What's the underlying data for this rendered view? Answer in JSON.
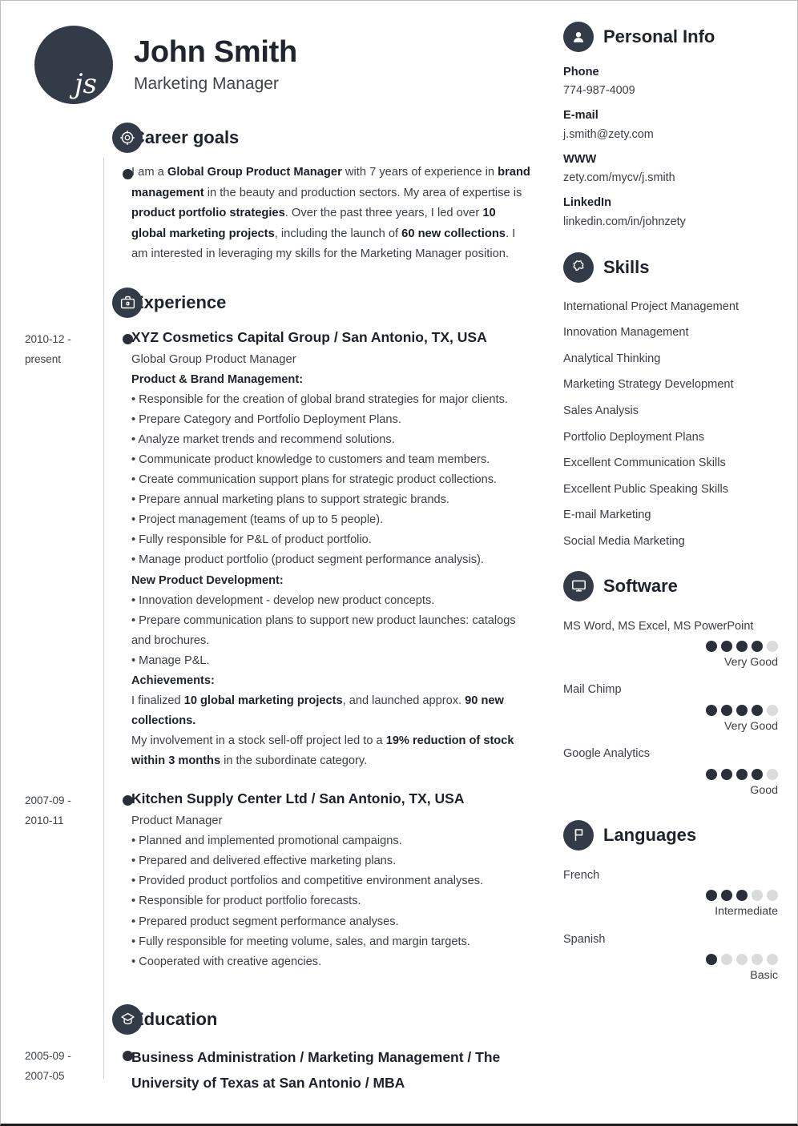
{
  "header": {
    "avatar_initials": "js",
    "full_name": "John Smith",
    "job_title": "Marketing Manager"
  },
  "sections": {
    "career_goals": {
      "title": "Career goals",
      "icon": "target-icon",
      "text_parts": [
        {
          "t": "I am a ",
          "b": false
        },
        {
          "t": "Global Group Product Manager",
          "b": true
        },
        {
          "t": " with 7 years of experience in ",
          "b": false
        },
        {
          "t": "brand management",
          "b": true
        },
        {
          "t": " in the beauty and production sectors. My area of expertise is ",
          "b": false
        },
        {
          "t": "product portfolio strategies",
          "b": true
        },
        {
          "t": ". Over the past three years, I led over ",
          "b": false
        },
        {
          "t": "10 global marketing projects",
          "b": true
        },
        {
          "t": ", including the launch of ",
          "b": false
        },
        {
          "t": "60 new collections",
          "b": true
        },
        {
          "t": ". I am interested in leveraging my skills for the Marketing Manager position.",
          "b": false
        }
      ]
    },
    "experience": {
      "title": "Experience",
      "icon": "briefcase-icon",
      "entries": [
        {
          "date": "2010-12 - present",
          "heading": "XYZ Cosmetics Capital Group / San Antonio, TX, USA",
          "subtitle": "Global Group Product Manager",
          "blocks": [
            {
              "kind": "group",
              "text": "Product & Brand Management:"
            },
            {
              "kind": "bullet",
              "text": "• Responsible for the creation of global brand strategies for major clients."
            },
            {
              "kind": "bullet",
              "text": "• Prepare Category and Portfolio Deployment Plans."
            },
            {
              "kind": "bullet",
              "text": "• Analyze market trends and recommend solutions."
            },
            {
              "kind": "bullet",
              "text": "• Communicate product knowledge to customers and team members."
            },
            {
              "kind": "bullet",
              "text": "• Create communication support plans for strategic product collections."
            },
            {
              "kind": "bullet",
              "text": "• Prepare annual marketing plans to support strategic brands."
            },
            {
              "kind": "bullet",
              "text": "• Project management (teams of up to 5 people)."
            },
            {
              "kind": "bullet",
              "text": "• Fully responsible for P&L of product portfolio."
            },
            {
              "kind": "bullet",
              "text": "• Manage product portfolio (product segment performance analysis)."
            },
            {
              "kind": "group",
              "text": "New Product Development:"
            },
            {
              "kind": "bullet",
              "text": "• Innovation development - develop new product concepts."
            },
            {
              "kind": "bullet",
              "text": "• Prepare communication plans to support new product launches: catalogs and brochures."
            },
            {
              "kind": "bullet",
              "text": "• Manage P&L."
            },
            {
              "kind": "group",
              "text": "Achievements:"
            },
            {
              "kind": "rich",
              "parts": [
                {
                  "t": "I finalized ",
                  "b": false
                },
                {
                  "t": "10 global marketing projects",
                  "b": true
                },
                {
                  "t": ", and launched approx. ",
                  "b": false
                },
                {
                  "t": "90 new collections.",
                  "b": true
                }
              ]
            },
            {
              "kind": "rich",
              "parts": [
                {
                  "t": "My involvement in a stock sell-off project led to a ",
                  "b": false
                },
                {
                  "t": "19% reduction of stock within 3 months",
                  "b": true
                },
                {
                  "t": " in the subordinate category.",
                  "b": false
                }
              ]
            }
          ]
        },
        {
          "date": "2007-09 - 2010-11",
          "heading": "Kitchen Supply Center Ltd / San Antonio, TX, USA",
          "subtitle": "Product Manager",
          "blocks": [
            {
              "kind": "bullet",
              "text": "• Planned and implemented promotional campaigns."
            },
            {
              "kind": "bullet",
              "text": "• Prepared and delivered effective marketing plans."
            },
            {
              "kind": "bullet",
              "text": "• Provided product portfolios and competitive environment analyses."
            },
            {
              "kind": "bullet",
              "text": "• Responsible for product portfolio forecasts."
            },
            {
              "kind": "bullet",
              "text": "• Prepared product segment performance analyses."
            },
            {
              "kind": "bullet",
              "text": "• Fully responsible for meeting volume, sales, and margin targets."
            },
            {
              "kind": "bullet",
              "text": "• Cooperated with creative agencies."
            }
          ]
        }
      ]
    },
    "education": {
      "title": "Education",
      "icon": "graduation-cap-icon",
      "entries": [
        {
          "date": "2005-09 - 2007-05",
          "heading": "Business Administration / Marketing Management / The University of Texas at San Antonio / MBA"
        }
      ]
    }
  },
  "sidebar": {
    "personal_info": {
      "title": "Personal Info",
      "icon": "person-icon",
      "fields": [
        {
          "label": "Phone",
          "value": "774-987-4009"
        },
        {
          "label": "E-mail",
          "value": "j.smith@zety.com"
        },
        {
          "label": "WWW",
          "value": "zety.com/mycv/j.smith"
        },
        {
          "label": "LinkedIn",
          "value": "linkedin.com/in/johnzety"
        }
      ]
    },
    "skills": {
      "title": "Skills",
      "icon": "puzzle-piece-icon",
      "items": [
        "International Project Management",
        "Innovation Management",
        "Analytical Thinking",
        "Marketing Strategy Development",
        "Sales Analysis",
        "Portfolio Deployment Plans",
        "Excellent Communication Skills",
        "Excellent Public Speaking Skills",
        "E-mail Marketing",
        "Social Media Marketing"
      ]
    },
    "software": {
      "title": "Software",
      "icon": "monitor-icon",
      "items": [
        {
          "name": "MS Word, MS Excel, MS PowerPoint",
          "filled": 4,
          "total": 5,
          "level": "Very Good"
        },
        {
          "name": "Mail Chimp",
          "filled": 4,
          "total": 5,
          "level": "Very Good"
        },
        {
          "name": "Google Analytics",
          "filled": 4,
          "total": 5,
          "level": "Good"
        }
      ]
    },
    "languages": {
      "title": "Languages",
      "icon": "flag-icon",
      "items": [
        {
          "name": "French",
          "filled": 3,
          "total": 5,
          "level": "Intermediate"
        },
        {
          "name": "Spanish",
          "filled": 1,
          "total": 5,
          "level": "Basic"
        }
      ]
    }
  },
  "colors": {
    "dark": "#333a48",
    "text": "#3a3e47",
    "heading": "#1d212b",
    "dot_off": "#d9dbdd",
    "spine": "#cfd2d6"
  }
}
